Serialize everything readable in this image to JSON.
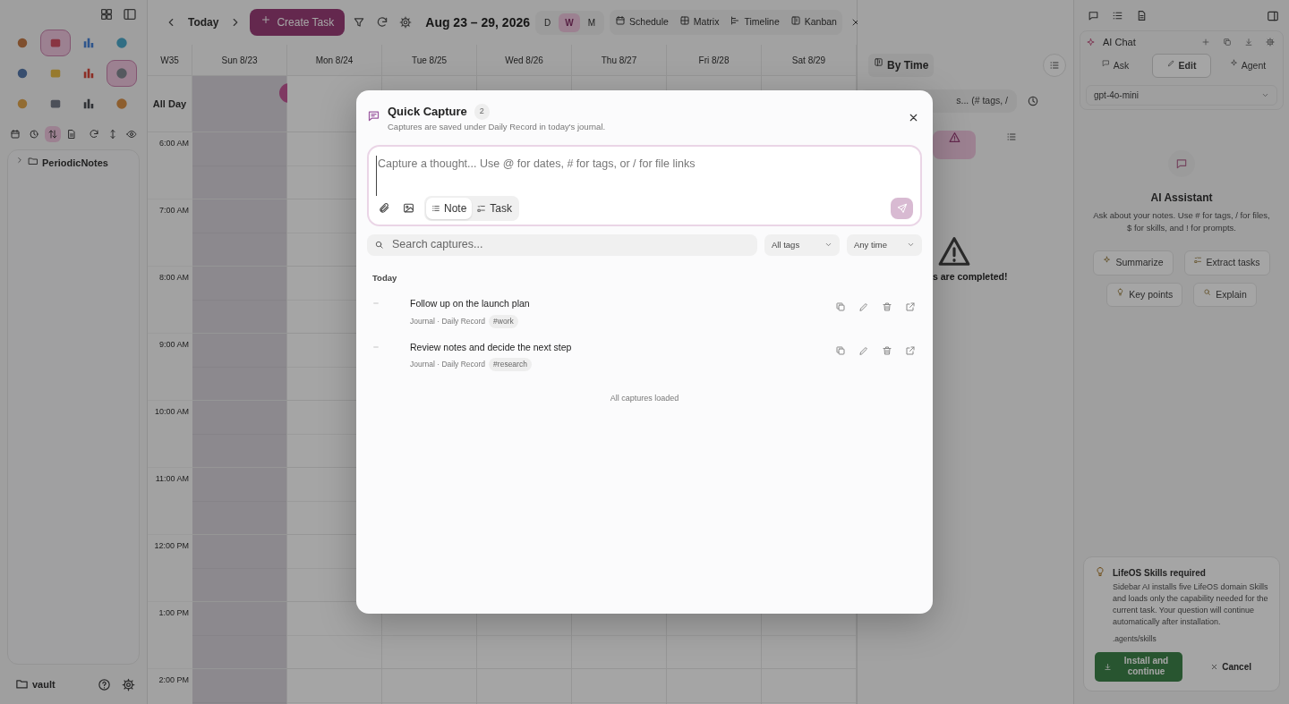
{
  "left_sidebar": {
    "apps": [
      {
        "selected": false
      },
      {
        "selected": true
      },
      {
        "selected": false
      },
      {
        "selected": false
      },
      {
        "selected": false
      },
      {
        "selected": false
      },
      {
        "selected": false
      },
      {
        "selected": true
      },
      {
        "selected": false
      },
      {
        "selected": false
      },
      {
        "selected": false
      },
      {
        "selected": false
      }
    ],
    "tree": [
      {
        "label": "PeriodicNotes"
      }
    ],
    "vault": "vault"
  },
  "calendar": {
    "today": "Today",
    "create_task": "Create Task",
    "range": "Aug 23 – 29, 2026",
    "views": [
      {
        "label": "D",
        "selected": false
      },
      {
        "label": "W",
        "selected": true
      },
      {
        "label": "M",
        "selected": false
      }
    ],
    "modes": [
      "Schedule",
      "Matrix",
      "Timeline",
      "Kanban"
    ],
    "week": "W35",
    "days": [
      {
        "label": "Sun 8/23",
        "today": true
      },
      {
        "label": "Mon 8/24",
        "today": false
      },
      {
        "label": "Tue 8/25",
        "today": false
      },
      {
        "label": "Wed 8/26",
        "today": false
      },
      {
        "label": "Thu 8/27",
        "today": false
      },
      {
        "label": "Fri 8/28",
        "today": false
      },
      {
        "label": "Sat 8/29",
        "today": false
      }
    ],
    "all_day": "All Day",
    "hours": [
      "6:00 AM",
      "7:00 AM",
      "8:00 AM",
      "9:00 AM",
      "10:00 AM",
      "11:00 AM",
      "12:00 PM",
      "1:00 PM",
      "2:00 PM"
    ]
  },
  "tasks_panel": {
    "group": "By Time",
    "search_text": "s... (# tags, /",
    "message": "s are completed!"
  },
  "ai_panel": {
    "title": "AI Chat",
    "modes": [
      {
        "label": "Ask",
        "selected": false
      },
      {
        "label": "Edit",
        "selected": true
      },
      {
        "label": "Agent",
        "selected": false
      }
    ],
    "model": "gpt-4o-mini",
    "heading": "AI Assistant",
    "description": "Ask about your notes. Use # for tags, / for files, $ for skills, and ! for prompts.",
    "actions": [
      "Summarize",
      "Extract tasks",
      "Key points",
      "Explain"
    ]
  },
  "notice": {
    "title": "LifeOS Skills required",
    "body": "Sidebar AI installs five LifeOS domain Skills and loads only the capability needed for the current task. Your question will continue automatically after installation.",
    "path": ".agents/skills",
    "install": "Install and continue",
    "cancel": "Cancel"
  },
  "modal": {
    "title": "Quick Capture",
    "count": "2",
    "subtitle": "Captures are saved under Daily Record in today's journal.",
    "input_placeholder": "Capture a thought... Use @ for dates, # for tags, or / for file links",
    "types": [
      {
        "label": "Note",
        "selected": true
      },
      {
        "label": "Task",
        "selected": false
      }
    ],
    "search_placeholder": "Search captures...",
    "filters": [
      "All tags",
      "Any time"
    ],
    "group": "Today",
    "items": [
      {
        "text": "Follow up on the launch plan",
        "meta": "Journal · Daily Record",
        "tag": "#work"
      },
      {
        "text": "Review notes and decide the next step",
        "meta": "Journal · Daily Record",
        "tag": "#research"
      }
    ],
    "footer": "All captures loaded"
  }
}
